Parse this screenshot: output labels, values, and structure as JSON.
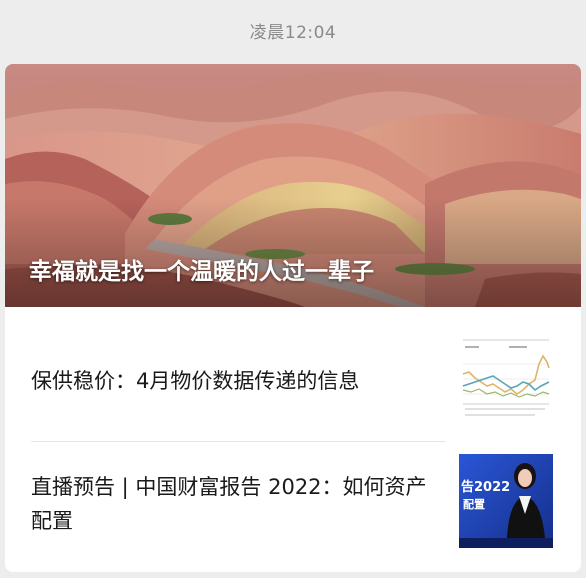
{
  "timestamp": "凌晨12:04",
  "cover": {
    "title": "幸福就是找一个温暖的人过一辈子",
    "image": "rainbow-mountains-photo"
  },
  "articles": [
    {
      "title": "保供稳价：4月物价数据传递的信息",
      "thumbnail": "line-chart-thumbnail"
    },
    {
      "title": "直播预告 | 中国财富报告 2022：如何资产配置",
      "thumbnail": "livestream-presenter-thumbnail",
      "thumbnail_text": {
        "headline": "告2022",
        "sub": "配置"
      }
    }
  ],
  "colors": {
    "background": "#ededed",
    "card": "#ffffff",
    "timestamp": "#8a8a8a",
    "title_text": "#1a1a1a",
    "live_thumb_bg": "#1e3fa8"
  }
}
